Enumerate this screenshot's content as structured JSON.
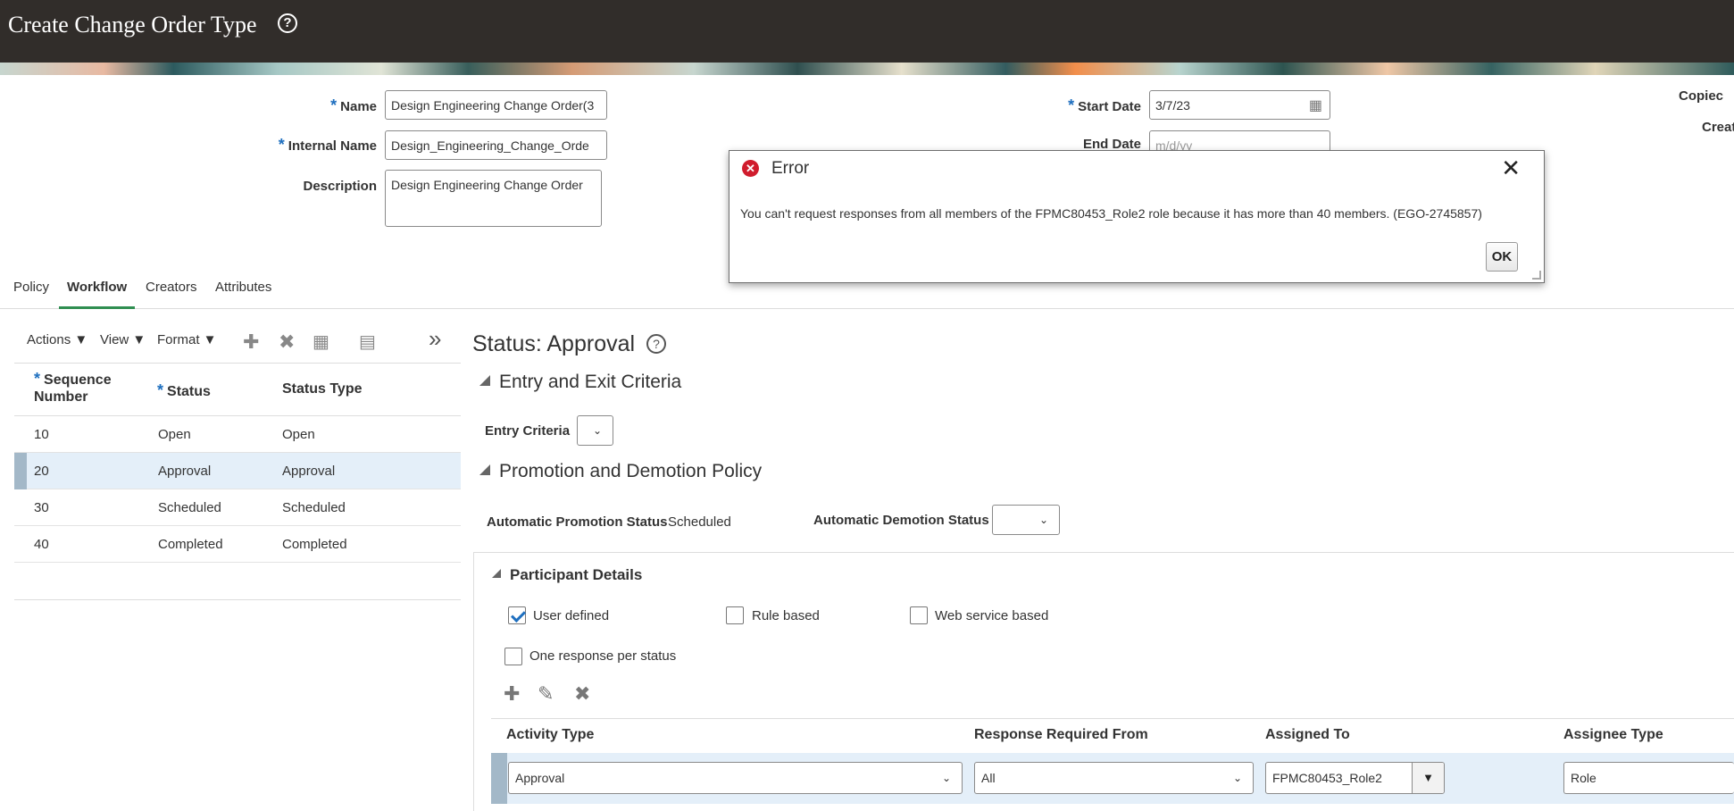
{
  "header": {
    "title": "Create Change Order Type",
    "help": "?"
  },
  "form": {
    "name_label": "Name",
    "name_value": "Design Engineering Change Order(3",
    "internal_name_label": "Internal Name",
    "internal_name_value": "Design_Engineering_Change_Orde",
    "description_label": "Description",
    "description_value": "Design Engineering Change Order",
    "start_date_label": "Start Date",
    "start_date_value": "3/7/23",
    "end_date_label": "End Date",
    "end_date_placeholder": "m/d/yy",
    "copied_label": "Copiec",
    "created_label": "Creat"
  },
  "tabs": [
    "Policy",
    "Workflow",
    "Creators",
    "Attributes"
  ],
  "toolbar": {
    "actions": "Actions",
    "view": "View",
    "format": "Format",
    "more": "»"
  },
  "status_grid": {
    "headers": {
      "sequence_line1": "Sequence",
      "sequence_line2": "Number",
      "status": "Status",
      "status_type": "Status Type"
    },
    "rows": [
      {
        "seq": "10",
        "status": "Open",
        "type": "Open"
      },
      {
        "seq": "20",
        "status": "Approval",
        "type": "Approval"
      },
      {
        "seq": "30",
        "status": "Scheduled",
        "type": "Scheduled"
      },
      {
        "seq": "40",
        "status": "Completed",
        "type": "Completed"
      }
    ]
  },
  "detail": {
    "status_title": "Status: Approval",
    "entry_exit_title": "Entry and Exit Criteria",
    "entry_criteria_label": "Entry Criteria",
    "promotion_title": "Promotion and Demotion Policy",
    "auto_promotion_label": "Automatic Promotion Status",
    "auto_promotion_value": "Scheduled",
    "auto_demotion_label": "Automatic Demotion Status",
    "participant_title": "Participant Details",
    "user_defined": "User defined",
    "rule_based": "Rule based",
    "web_service_based": "Web service based",
    "one_response": "One response per status",
    "participants": {
      "headers": {
        "activity_type": "Activity Type",
        "response_required": "Response Required From",
        "assigned_to": "Assigned To",
        "assignee_type": "Assignee Type"
      },
      "row": {
        "activity_type": "Approval",
        "response_required": "All",
        "assigned_to": "FPMC80453_Role2",
        "assignee_type": "Role"
      }
    }
  },
  "dialog": {
    "title": "Error",
    "message": "You can't request responses from all members of the FPMC80453_Role2 role because it has more than 40 members. (EGO-2745857)",
    "ok": "OK",
    "close": "✕"
  },
  "colors": {
    "header_bg": "#312d2a",
    "accent_blue": "#1e6fbf",
    "error_red": "#d01c2d",
    "selected_row": "#e4eff9",
    "tab_active": "#2f8e51"
  }
}
